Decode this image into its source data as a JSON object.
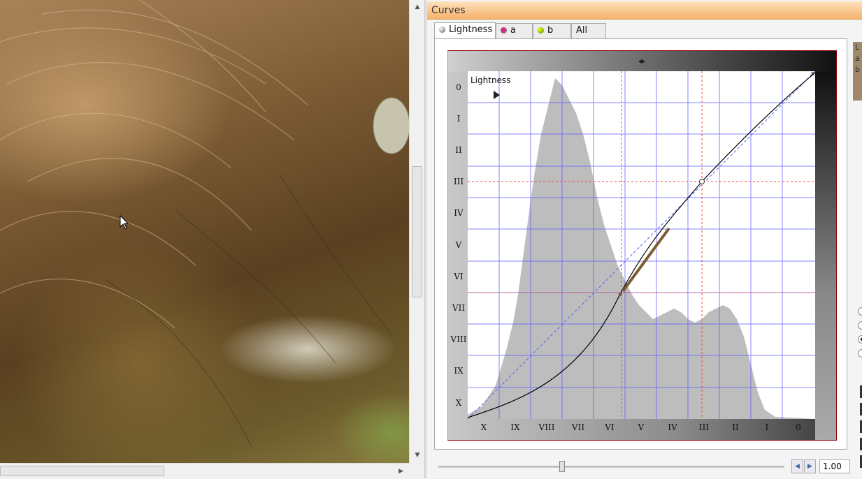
{
  "panel": {
    "title": "Curves"
  },
  "tabs": [
    {
      "label": "Lightness",
      "active": true,
      "dot_color": "#777777"
    },
    {
      "label": "a",
      "active": false,
      "dot_color": "#b04080"
    },
    {
      "label": "b",
      "active": false,
      "dot_color": "#60a040"
    },
    {
      "label": "All",
      "active": false
    }
  ],
  "graph": {
    "channel_label": "Lightness",
    "y_zones": [
      "0",
      "I",
      "II",
      "III",
      "IV",
      "V",
      "VI",
      "VII",
      "VIII",
      "IX",
      "X"
    ],
    "x_zones": [
      "X",
      "IX",
      "VIII",
      "VII",
      "VI",
      "V",
      "IV",
      "III",
      "II",
      "I",
      "0"
    ]
  },
  "side_card": {
    "lines": [
      "L",
      "a",
      "b"
    ]
  },
  "zoom": {
    "value": "1.00",
    "slider_fraction": 0.35
  },
  "colors": {
    "title_bar": "#f6b26b",
    "grid": "#5c5cff",
    "guide": "#ff4040",
    "histogram": "#bdbdbd"
  }
}
